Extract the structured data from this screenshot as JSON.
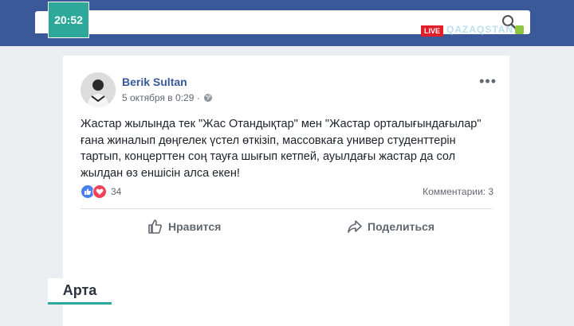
{
  "overlay": {
    "clock": "20:52",
    "live_label": "LIVE",
    "channel_name": "QAZAQSTAN",
    "program_title": "Арта"
  },
  "topbar": {
    "brand_color": "#3b5998",
    "search_icon": "search-icon"
  },
  "post": {
    "author": "Berik Sultan",
    "timestamp": "5 октября в 0:29 ·",
    "privacy_icon": "globe-icon",
    "more_icon": "more-options-icon",
    "text_lines": [
      "Жастар жылында тек \"Жас Отандықтар\" мен \"Жастар орталығындағылар\"",
      "ғана жиналып дөңгелек үстел өткізіп, массовкаға универ студенттерін",
      "тартып, концерттен соң тауға шығып кетпей, ауылдағы жастар да сол",
      "жылдан өз еншісін алса екен!"
    ],
    "reactions": {
      "types": [
        "like",
        "love"
      ],
      "count": "34"
    },
    "comments_label": "Комментарии: 3",
    "actions": {
      "like_label": "Нравится",
      "share_label": "Поделиться"
    }
  }
}
